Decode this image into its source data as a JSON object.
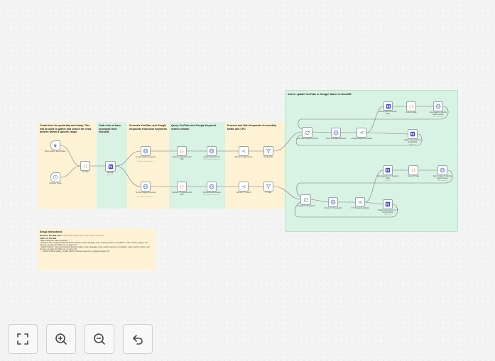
{
  "notes": {
    "create_time": "Create time for yesterday and today. This will be used to gather and search for news articles within a specific range.",
    "base_keywords": "Grab a list of base keywords from NocoDB",
    "google_yt": "Generate YouTube and Google Keywords from base keywords",
    "query": "Query YouTube and Google Keyword search volume.",
    "process": "Process and filter Keywords for monthly traffic and CPC",
    "add_update": "Add or update YouTube or Google Tables in NocoDB",
    "setup_title": "Setup Instructions",
    "setup_required_prefix": "Required: NocoDB, APIs:",
    "setup_required_links": "DataForSEO (Keywords), Google Tables (Creative)",
    "setup_tables_heading": "Tables for NocoDB",
    "setup_lines": [
      "- Base Keywords: Base Keywords",
      "- Search & Geo: Google Keywords Source-location, code, language, code, search_partners, competition, index, search_volume, cpc,",
      "  low_top_of_page_bid, high_top_of_page_bid",
      "- Search Volume: YouTube Keywords Source-location_code, language_code, search_partners, competition, index, search_volume, cpc,",
      "  low_top_of_page_bid, high_top_of_page_bid",
      "- ... Search Volume (value_of_date, search_volume, keyword_id, google_keyword_id)"
    ]
  },
  "nodes": {
    "trigger_schedule": {
      "label": "When clicking 'Test workflow'"
    },
    "trigger_cron": {
      "label": "Schedule Trigger"
    },
    "set_time": {
      "label": "Set Time"
    },
    "nocodb": {
      "label": "NocoDB",
      "sub": "get: 1 item"
    },
    "google_suggest": {
      "label": "Google Suggest Keywords",
      "sub": "POST: https://api.dataforseo..."
    },
    "yt_suggest": {
      "label": "YouTube Suggest Keywords",
      "sub": "POST: https://api.dataforseo..."
    },
    "combine_google": {
      "label": "Combine & Keywords and Filter"
    },
    "combine_yt": {
      "label": "Combine YT Keywords and Filter"
    },
    "google_volume": {
      "label": "Google Search Volume",
      "sub": "POST: https://api.dataforseo..."
    },
    "yt_volume": {
      "label": "YouTube Search Volume",
      "sub": "POST: https://api.dataforseo..."
    },
    "split_google": {
      "label": "Split Out Google Search"
    },
    "split_yt": {
      "label": "Split Out YT Search"
    },
    "google_filter": {
      "label": "Google Filter"
    },
    "yt_filter": {
      "label": "YT Filter"
    },
    "loop_google": {
      "label": "Loop Over Google Keywords"
    },
    "loop_yt": {
      "label": "Loop Over YT Keywords"
    },
    "check_google": {
      "label": "Check for Google Keywords"
    },
    "check_yt": {
      "label": "Check for YT Keywords"
    },
    "if_google": {
      "label": "If Google Keywords Available"
    },
    "if_yt": {
      "label": "If YT Keywords Available"
    },
    "add_google": {
      "label": "Add Keyword To Google Table",
      "sub": "create: row"
    },
    "format_google": {
      "label": "Format G Date"
    },
    "note_google": {
      "label": "Note Search G Monthly Search Volume",
      "sub": "POST: https://api..."
    },
    "update_google": {
      "label": "Update Keyword Row in Google Table",
      "sub": "update: row"
    },
    "add_yt": {
      "label": "Add Keyword To YT Keyword Table",
      "sub": "create: row"
    },
    "format_yt": {
      "label": "Format YT Date"
    },
    "note_yt": {
      "label": "Add YouTube YT Monthly Search Volume",
      "sub": "POST: https://api..."
    },
    "update_yt": {
      "label": "Update Keyword Row in YT Keyword Table",
      "sub": "update: row"
    }
  },
  "controls": {
    "fit": "fit-view",
    "zoom_in": "zoom-in",
    "zoom_out": "zoom-out",
    "reset": "reset-zoom"
  },
  "colors": {
    "sticky_yellow": "#fdf3d4",
    "sticky_green": "#d8f3e3",
    "connector": "#777777",
    "nocodb": "#3b4bd6",
    "http": "#5a78c4",
    "code": "#ff8b3d",
    "filter": "#6b7bbd",
    "if": "#2f9e6d",
    "trigger": "#6a9bd8"
  }
}
